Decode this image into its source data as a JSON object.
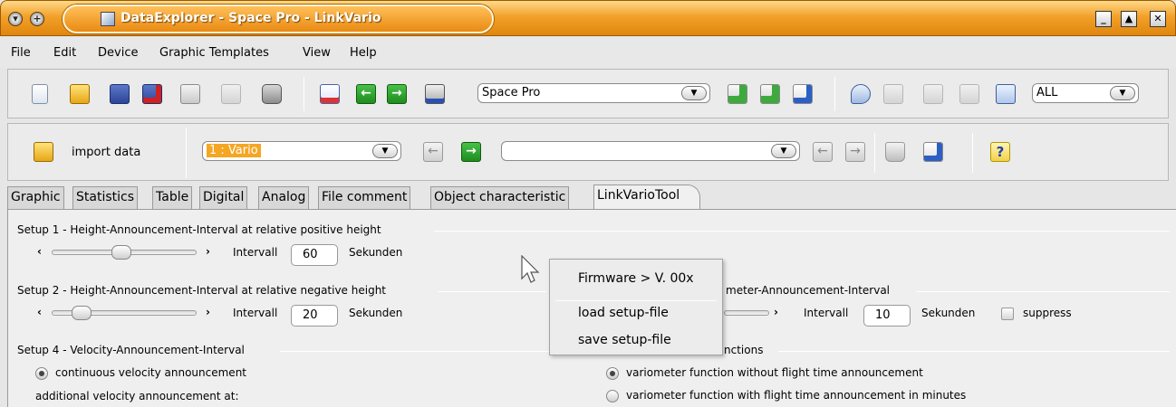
{
  "window": {
    "title": "DataExplorer  -  Space Pro  -  LinkVario",
    "accent": "#f2a12a",
    "controls": [
      "minimize-icon",
      "maximize-icon",
      "close-icon"
    ]
  },
  "menu": [
    "File",
    "Edit",
    "Device",
    "Graphic Templates",
    "View",
    "Help"
  ],
  "toolbar1": {
    "device_select": "Space Pro",
    "channel_filter": "ALL"
  },
  "toolbar2": {
    "import_label": "import data",
    "record_select": "1 : Vario",
    "record_select2": ""
  },
  "tabs": [
    "Graphic",
    "Statistics",
    "Table",
    "Digital",
    "Analog",
    "File comment",
    "Object characteristic",
    "LinkVarioTool"
  ],
  "active_tab": "LinkVarioTool",
  "setup1": {
    "title": "Setup 1 - Height-Announcement-Interval at relative positive height",
    "interval_label": "Intervall",
    "value": "60",
    "unit": "Sekunden",
    "slider_level": 0.48
  },
  "setup2": {
    "title": "Setup 2 - Height-Announcement-Interval at relative negative height",
    "interval_label": "Intervall",
    "value": "20",
    "unit": "Sekunden",
    "slider_level": 0.16
  },
  "setup3": {
    "title_visible": "meter-Announcement-Interval",
    "interval_label": "Intervall",
    "value": "10",
    "unit": "Sekunden",
    "suppress_label": "suppress"
  },
  "setup4": {
    "title": "Setup 4 - Velocity-Announcement-Interval",
    "option1": "continuous velocity announcement",
    "option2": "additional velocity announcement at:"
  },
  "setup5": {
    "title_visible": "nctions",
    "option1": "variometer function without flight time announcement",
    "option2": "variometer function with flight time announcement in minutes"
  },
  "popup": {
    "firmware": "Firmware > V. 00x",
    "load": "load setup-file",
    "save": "save setup-file"
  }
}
